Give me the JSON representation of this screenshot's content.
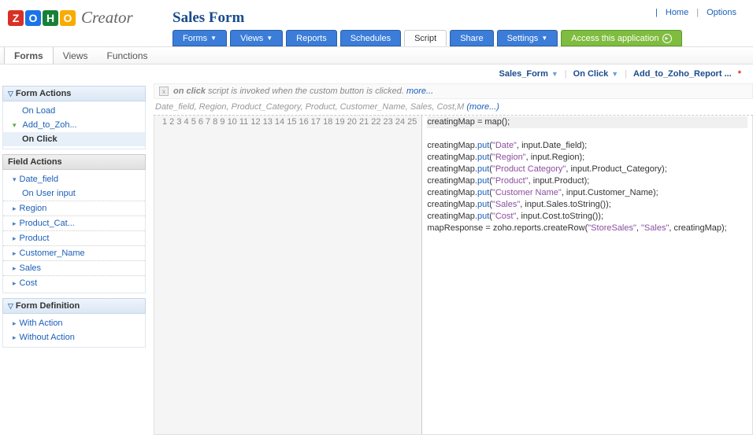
{
  "app": {
    "title": "Sales Form",
    "creator_label": "Creator"
  },
  "top_links": {
    "home": "Home",
    "options": "Options"
  },
  "main_nav": {
    "forms": "Forms",
    "views": "Views",
    "reports": "Reports",
    "schedules": "Schedules",
    "script": "Script",
    "share": "Share",
    "settings": "Settings",
    "access": "Access this application"
  },
  "sub_nav": {
    "forms": "Forms",
    "views": "Views",
    "functions": "Functions"
  },
  "breadcrumb": {
    "a": "Sales_Form",
    "b": "On Click",
    "c": "Add_to_Zoho_Report ..."
  },
  "panels": {
    "form_actions": {
      "title": "Form Actions",
      "on_load": "On Load",
      "add_to": "Add_to_Zoh...",
      "on_click": "On Click"
    },
    "field_actions": {
      "title": "Field Actions",
      "date_field": "Date_field",
      "on_user_input": "On User input",
      "region": "Region",
      "product_cat": "Product_Cat...",
      "product": "Product",
      "customer_name": "Customer_Name",
      "sales": "Sales",
      "cost": "Cost"
    },
    "form_def": {
      "title": "Form Definition",
      "with_action": "With Action",
      "without_action": "Without Action"
    }
  },
  "hint": {
    "prefix": "on click",
    "text": "script is invoked when the custom button is clicked.",
    "more": "more..."
  },
  "params": {
    "list": "Date_field, Region, Product_Category, Product, Customer_Name, Sales, Cost,M ",
    "more": "(more...)"
  },
  "code": {
    "lines_total": 25,
    "lines": [
      {
        "plain": "creatingMap = map();",
        "hl": true
      },
      {
        "pre": "creatingMap.",
        "fn": "put",
        "open": "(",
        "str": "\"Date\"",
        "post": ", input.Date_field);"
      },
      {
        "pre": "creatingMap.",
        "fn": "put",
        "open": "(",
        "str": "\"Region\"",
        "post": ", input.Region);"
      },
      {
        "pre": "creatingMap.",
        "fn": "put",
        "open": "(",
        "str": "\"Product Category\"",
        "post": ", input.Product_Category);"
      },
      {
        "pre": "creatingMap.",
        "fn": "put",
        "open": "(",
        "str": "\"Product\"",
        "post": ", input.Product);"
      },
      {
        "pre": "creatingMap.",
        "fn": "put",
        "open": "(",
        "str": "\"Customer Name\"",
        "post": ", input.Customer_Name);"
      },
      {
        "pre": "creatingMap.",
        "fn": "put",
        "open": "(",
        "str": "\"Sales\"",
        "post": ", input.Sales.toString());"
      },
      {
        "pre": "creatingMap.",
        "fn": "put",
        "open": "(",
        "str": "\"Cost\"",
        "post": ", input.Cost.toString());"
      },
      {
        "pre": "mapResponse = zoho.reports.createRow(",
        "str": "\"StoreSales\"",
        "mid": ", ",
        "str2": "\"Sales\"",
        "post": ", creatingMap);"
      }
    ]
  }
}
